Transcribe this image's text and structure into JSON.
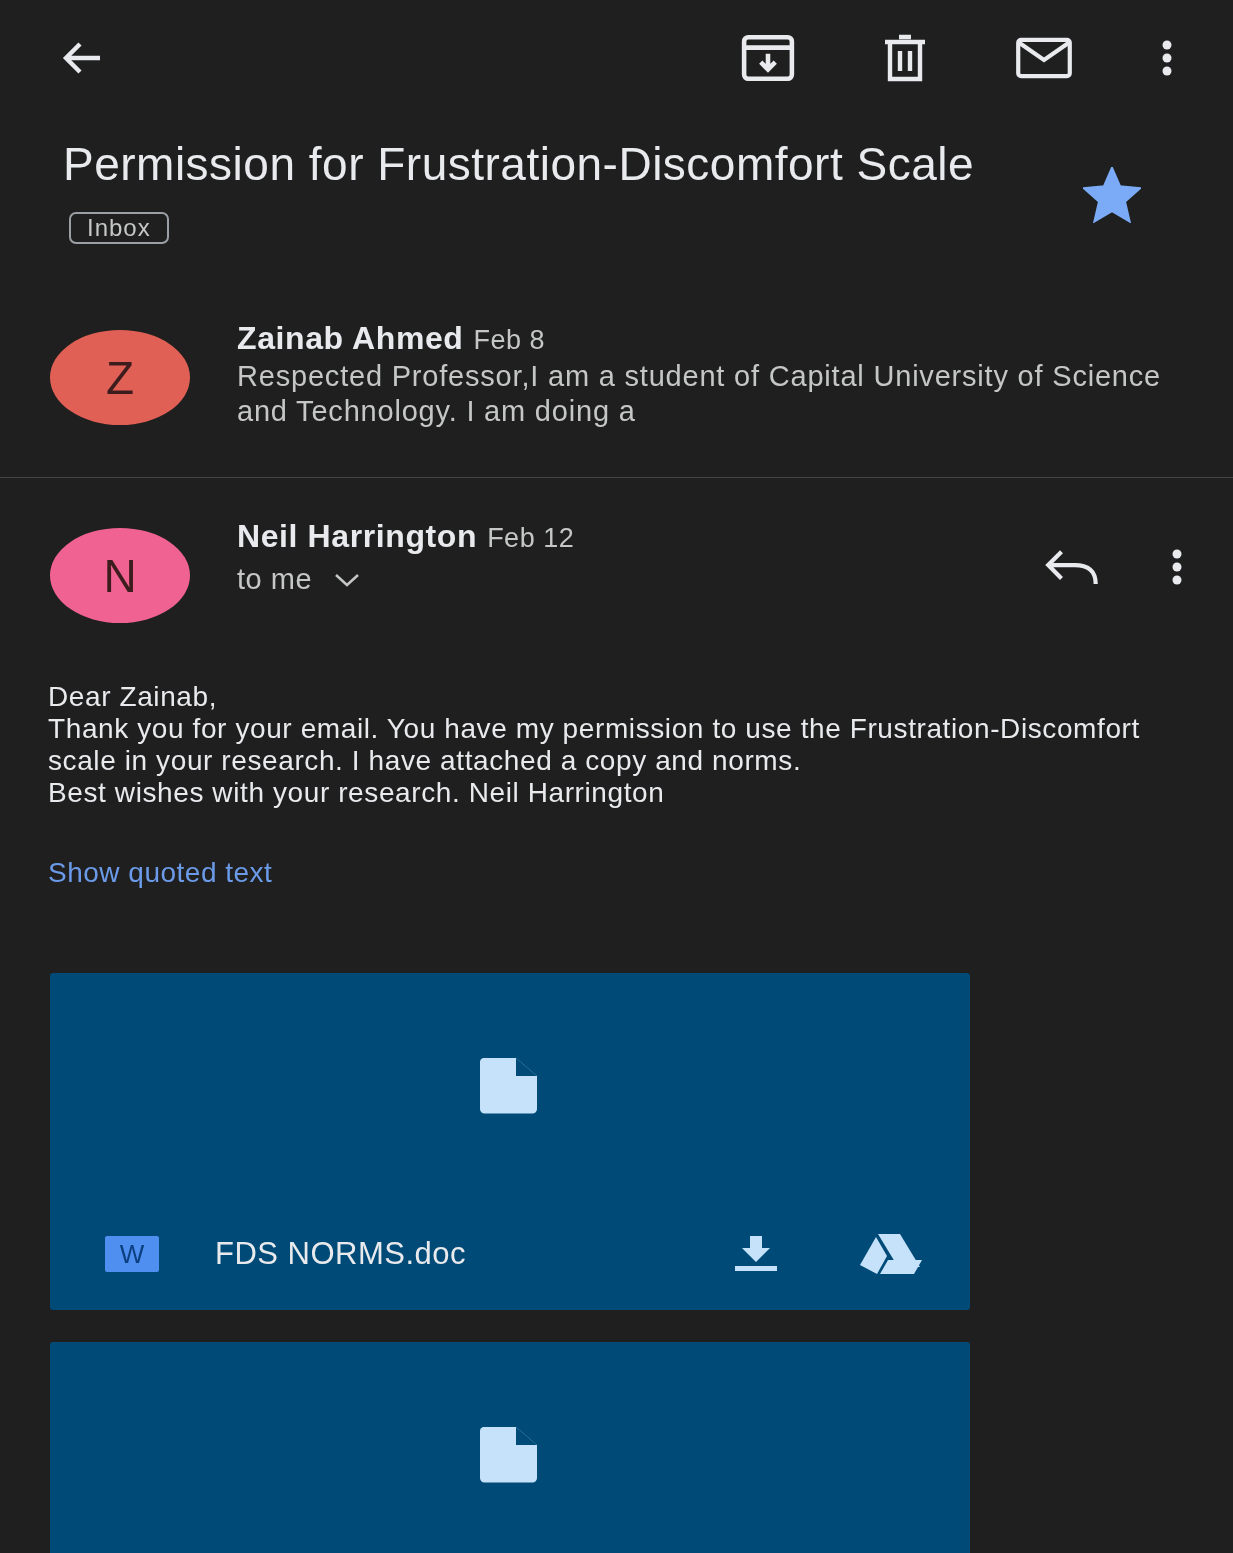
{
  "subject": {
    "title": "Permission for Frustration-Discomfort Scale",
    "label": "Inbox",
    "starred": true
  },
  "messages": [
    {
      "kind": "collapsed",
      "initial": "Z",
      "color": "#e06055",
      "sender": "Zainab Ahmed",
      "date": "Feb 8",
      "snippet": "Respected Professor,I am a student of Capital University of Science and Technology. I am doing a"
    },
    {
      "kind": "expanded",
      "initial": "N",
      "color": "#f06292",
      "sender": "Neil Harrington",
      "date": "Feb 12",
      "recipient": "to me",
      "body": [
        "Dear Zainab,",
        "Thank you for your email. You have my permission to use the Frustration-Discomfort scale in your research. I have attached a copy and norms.",
        "Best wishes with your research. Neil Harrington"
      ],
      "quoted_link": "Show quoted text",
      "attachments": [
        {
          "kind": "full",
          "badge": "W",
          "name": "FDS NORMS.doc"
        },
        {
          "kind": "preview"
        }
      ]
    }
  ]
}
